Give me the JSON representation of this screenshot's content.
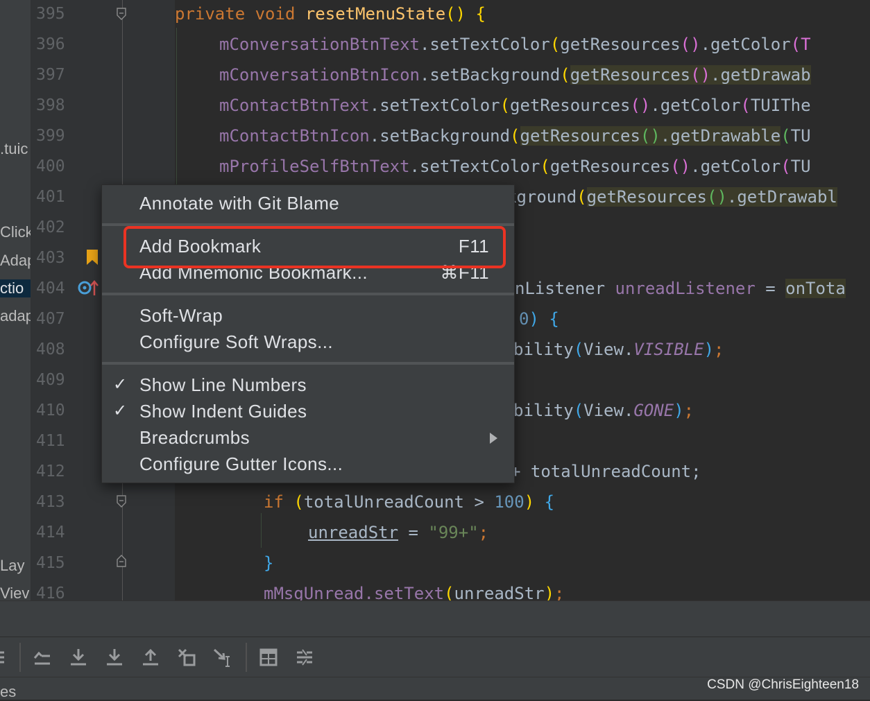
{
  "project_panel": {
    "items": [
      ".tuic",
      "Click",
      "Adap",
      "ctio",
      "adap",
      "Lay",
      "Viev"
    ]
  },
  "gutter": {
    "line_numbers": [
      "395",
      "396",
      "397",
      "398",
      "399",
      "400",
      "401",
      "402",
      "403",
      "404",
      "407",
      "408",
      "409",
      "410",
      "411",
      "412",
      "413",
      "414",
      "415",
      "416"
    ]
  },
  "code": {
    "l395": {
      "t1": "private",
      "t2": "void",
      "t3": "resetMenuState",
      "t4": "(",
      "t5": ")",
      "t6": "{"
    },
    "l396": {
      "t1": "mConversationBtnText",
      "t2": ".setTextColor",
      "t3": "(",
      "t4": "getResources",
      "t5": "()",
      "t6": ".getColor",
      "t7": "(T"
    },
    "l397": {
      "t1": "mConversationBtnIcon",
      "t2": ".setBackground",
      "t3": "(",
      "t4": "getResources",
      "t5": "()",
      "t6": ".getDrawab"
    },
    "l398": {
      "t1": "mContactBtnText",
      "t2": ".setTextColor",
      "t3": "(",
      "t4": "getResources",
      "t5": "()",
      "t6": ".getColor",
      "t7": "(",
      "t8": "TUIThe"
    },
    "l399": {
      "t1": "mContactBtnIcon",
      "t2": ".setBackground",
      "t3": "(",
      "t4": "getResources",
      "t5": "()",
      "t6": ".getDrawable",
      "t7": "(",
      "t8": "TU"
    },
    "l400": {
      "t1": "mProfileSelfBtnText",
      "t2": ".setTextColor",
      "t3": "(",
      "t4": "getResources",
      "t5": "()",
      "t6": ".getColor",
      "t7": "(",
      "t8": "TU"
    },
    "l401": {
      "t1": "kground",
      "t2": "(",
      "t3": "getResources",
      "t4": "()",
      "t5": ".getDrawabl"
    },
    "l404": {
      "t1": "nListener",
      "t2": "unreadListener",
      "t3": "=",
      "t4": "onTota"
    },
    "l407": {
      "t1": "0",
      "t2": ")",
      "t3": "{"
    },
    "l408": {
      "t1": "bility",
      "t2": "(",
      "t3": "View.",
      "t4": "VISIBLE",
      "t5": ")",
      "t6": ";"
    },
    "l410": {
      "t1": "bility",
      "t2": "(",
      "t3": "View.",
      "t4": "GONE",
      "t5": ")",
      "t6": ";"
    },
    "l412": {
      "t1": "+ totalUnreadCount;"
    },
    "l413": {
      "t1": "if",
      "t2": "(",
      "t3": "totalUnreadCount > ",
      "t4": "100",
      "t5": ")",
      "t6": "{"
    },
    "l414": {
      "t1": "unreadStr",
      "t2": " = ",
      "t3": "\"99+\"",
      "t4": ";"
    },
    "l415": {
      "t1": "}"
    },
    "l416": {
      "t1": "mMsgUnread.setText",
      "t2": "(",
      "t3": "unreadStr",
      "t4": ")",
      "t5": ";"
    }
  },
  "context_menu": {
    "annotate": "Annotate with Git Blame",
    "add_bookmark": "Add Bookmark",
    "add_bookmark_shortcut": "F11",
    "add_mnemonic": "Add Mnemonic Bookmark...",
    "add_mnemonic_shortcut": "⌘F11",
    "soft_wrap": "Soft-Wrap",
    "configure_soft_wraps": "Configure Soft Wraps...",
    "show_line_numbers": "Show Line Numbers",
    "show_indent_guides": "Show Indent Guides",
    "breadcrumbs": "Breadcrumbs",
    "configure_gutter_icons": "Configure Gutter Icons...",
    "checkmark": "✓"
  },
  "status_bar": {
    "left_text": "es",
    "watermark": "CSDN @ChrisEighteen18"
  },
  "icons": [
    "bookmark-icon",
    "implement-marker-icon",
    "fold-icon",
    "menu-icon",
    "scroll-up-icon",
    "scroll-down-icon",
    "download-icon",
    "upload-icon",
    "filter-icon",
    "cursor-icon",
    "table-icon",
    "diff-icon",
    "submenu-arrow-icon"
  ],
  "colors": {
    "highlight_box": "#ea3323",
    "editor_bg": "#2b2b2b",
    "menu_bg": "#3c3f41",
    "bookmark": "#e8a317"
  }
}
